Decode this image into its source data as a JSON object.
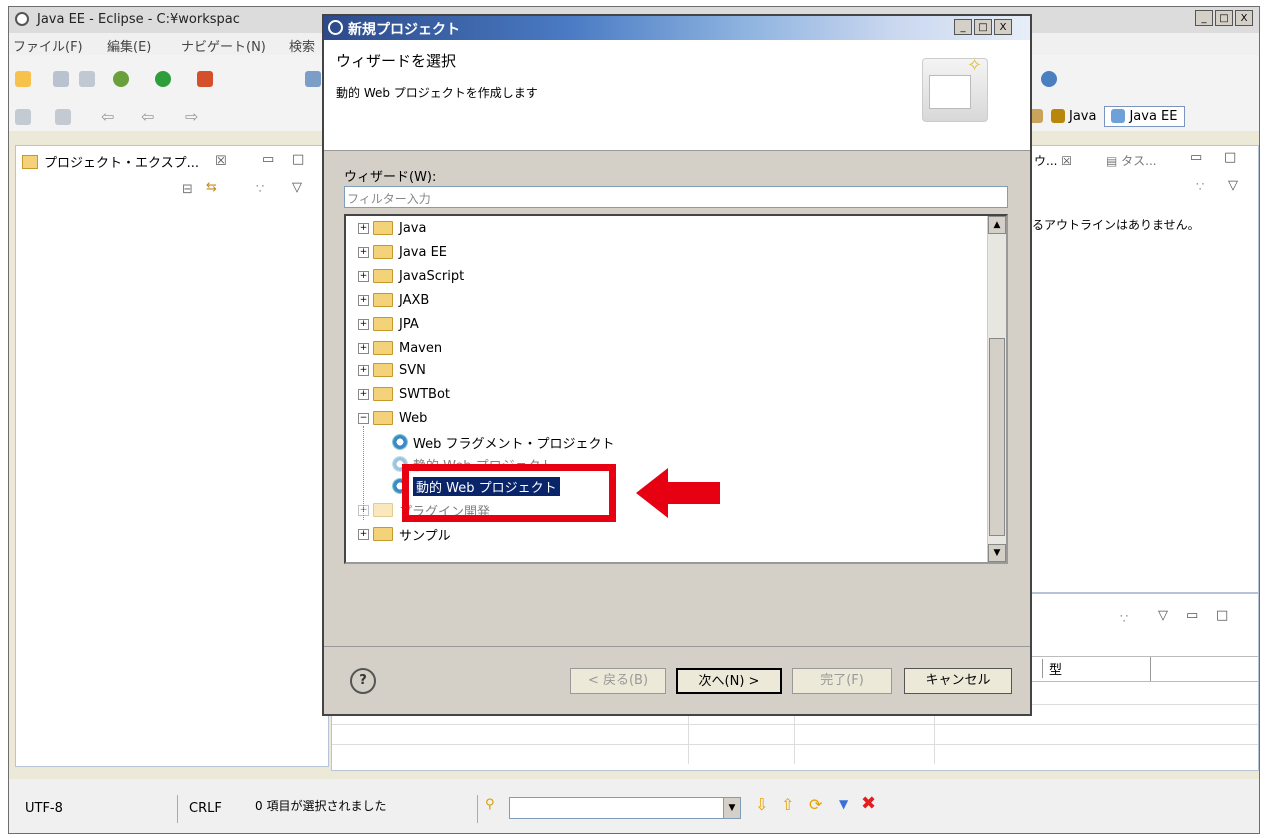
{
  "window": {
    "title": "Java EE - Eclipse - C:¥workspac",
    "min": "_",
    "max": "□",
    "close": "X"
  },
  "menubar": {
    "items": [
      "ファイル(F)",
      "編集(E)",
      "ナビゲート(N)",
      "検索"
    ]
  },
  "perspectives": {
    "java": "Java",
    "javaee": "Java EE"
  },
  "project_explorer": {
    "tab_label": "プロジェクト・エクスプ...",
    "close": "☒"
  },
  "outline": {
    "tab_label": "ウ...",
    "tasks_tab": "タス...",
    "message": "るアウトラインはありません。"
  },
  "bottom_table": {
    "headers": [
      "",
      "型",
      ""
    ]
  },
  "dialog": {
    "title": "新規プロジェクト",
    "header_title": "ウィザードを選択",
    "header_desc": "動的 Web プロジェクトを作成します",
    "wizard_label": "ウィザード(W):",
    "filter_placeholder": "フィルター入力",
    "tree": [
      {
        "label": "Java",
        "expanded": false
      },
      {
        "label": "Java EE",
        "expanded": false
      },
      {
        "label": "JavaScript",
        "expanded": false
      },
      {
        "label": "JAXB",
        "expanded": false
      },
      {
        "label": "JPA",
        "expanded": false
      },
      {
        "label": "Maven",
        "expanded": false
      },
      {
        "label": "SVN",
        "expanded": false
      },
      {
        "label": "SWTBot",
        "expanded": false
      },
      {
        "label": "Web",
        "expanded": true
      },
      {
        "label": "Web フラグメント・プロジェクト",
        "child": true
      },
      {
        "label": "静的 Web プロジェクト",
        "child": true
      },
      {
        "label": "動的 Web プロジェクト",
        "child": true,
        "selected": true
      },
      {
        "label": "プラグイン開発",
        "expanded": false
      },
      {
        "label": "サンプル",
        "expanded": false
      }
    ],
    "buttons": {
      "back": "< 戻る(B)",
      "next": "次へ(N) >",
      "finish": "完了(F)",
      "cancel": "キャンセル"
    },
    "help": "?"
  },
  "status": {
    "encoding": "UTF-8",
    "line_ending": "CRLF",
    "selection": "0 項目が選択されました"
  },
  "colors": {
    "highlight": "#e60012",
    "selection": "#0a246a",
    "title_blue": "#2d4a8a"
  }
}
